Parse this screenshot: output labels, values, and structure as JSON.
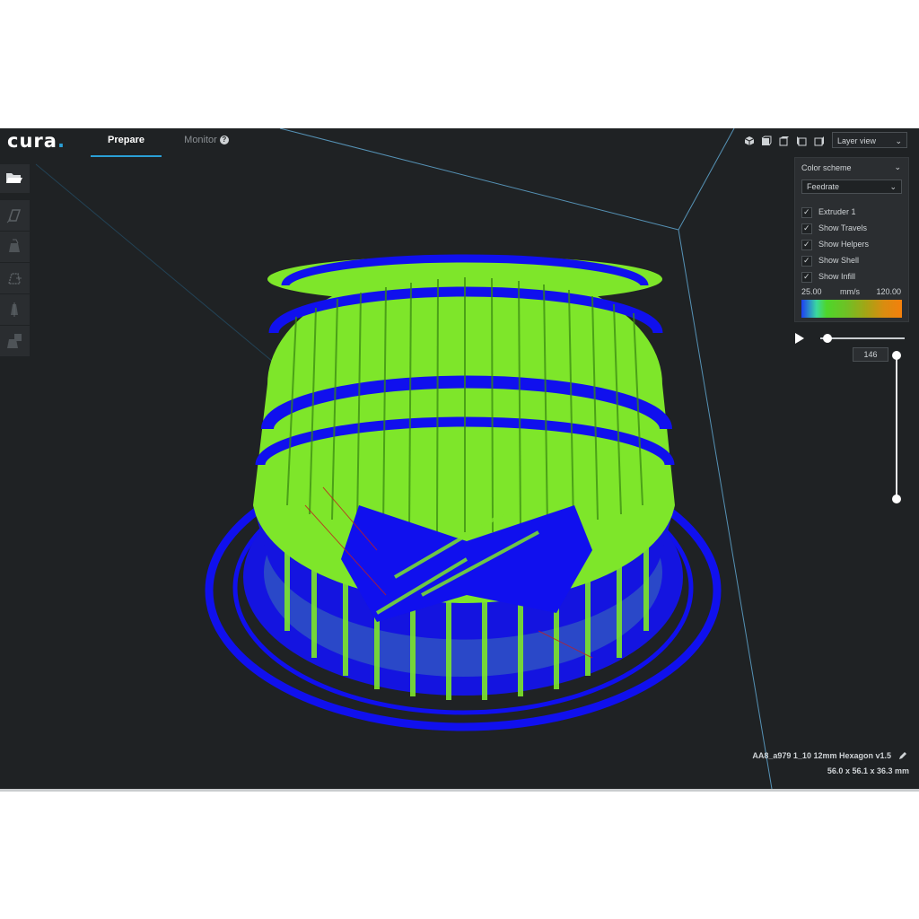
{
  "app": {
    "logo": "cura",
    "logo_dot": "."
  },
  "tabs": [
    {
      "label": "Prepare",
      "active": true
    },
    {
      "label": "Monitor",
      "active": false
    }
  ],
  "help_glyph": "?",
  "view": {
    "icons": [
      "3d-view-icon",
      "front-view-icon",
      "top-view-icon",
      "left-view-icon",
      "right-view-icon"
    ],
    "mode": "Layer view"
  },
  "left_tools": [
    "open-folder-icon",
    "move-icon",
    "scale-icon",
    "rotate-icon",
    "mirror-icon",
    "per-model-settings-icon"
  ],
  "panel": {
    "color_scheme_label": "Color scheme",
    "color_scheme_value": "Feedrate",
    "checkboxes": [
      {
        "label": "Extruder 1",
        "checked": true
      },
      {
        "label": "Show Travels",
        "checked": true
      },
      {
        "label": "Show Helpers",
        "checked": true
      },
      {
        "label": "Show Shell",
        "checked": true
      },
      {
        "label": "Show Infill",
        "checked": true
      }
    ],
    "range_min": "25.00",
    "range_unit": "mm/s",
    "range_max": "120.00"
  },
  "layers": {
    "current": "146"
  },
  "job": {
    "name": "AA8_a979 1_10 12mm Hexagon v1.5",
    "dimensions": "56.0 x 56.1 x 36.3 mm"
  },
  "colors": {
    "accent": "#2a9fd6",
    "background": "#1f2224",
    "shell": "#1010ee",
    "infill": "#7ee62a",
    "travel": "#c02020"
  }
}
